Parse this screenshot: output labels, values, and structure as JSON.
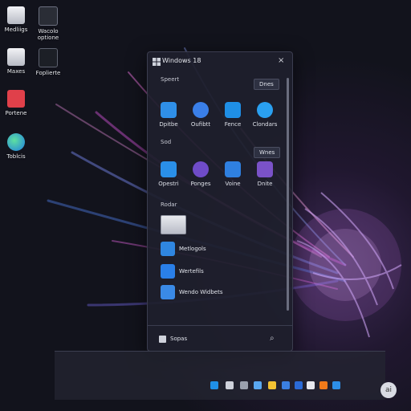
{
  "desktop": {
    "icons": [
      {
        "label": "Medliigs",
        "icon": "file-icon"
      },
      {
        "label": "Wacolo optione",
        "icon": "document-icon"
      },
      {
        "label": "Maxes",
        "icon": "file-icon"
      },
      {
        "label": "Foplierte",
        "icon": "document-icon"
      },
      {
        "label": "Portene",
        "icon": "search-app-icon"
      },
      {
        "label": "Toblcis",
        "icon": "edge-browser-icon"
      }
    ]
  },
  "start_panel": {
    "title": "Windows 18",
    "close": "×",
    "section1": {
      "label": "Speert",
      "button": "Dnes"
    },
    "apps_row1": [
      {
        "label": "Dpitbe",
        "icon": "folder-icon"
      },
      {
        "label": "Oufibtt",
        "icon": "messenger-icon"
      },
      {
        "label": "Fence",
        "icon": "download-icon"
      },
      {
        "label": "Clondars",
        "icon": "cloud-icon"
      }
    ],
    "section2": {
      "label": "Sod",
      "button": "Wnes"
    },
    "apps_row2": [
      {
        "label": "Opestri",
        "icon": "store-icon"
      },
      {
        "label": "Ponges",
        "icon": "power-icon"
      },
      {
        "label": "Voine",
        "icon": "widgets-icon"
      },
      {
        "label": "Dnite",
        "icon": "files-icon"
      }
    ],
    "section3": {
      "label": "Rodar"
    },
    "list": [
      {
        "label": "Metlogols",
        "icon": "app-icon"
      },
      {
        "label": "Wertefils",
        "icon": "refresh-icon"
      },
      {
        "label": "Wendo Widbets",
        "icon": "widgets-icon"
      }
    ],
    "footer": {
      "label": "Sopas",
      "search": "⌕"
    }
  },
  "taskbar": {
    "ai_badge": "ai",
    "colors": [
      "#1f8fe6",
      "#cfd2db",
      "#9aa0ad",
      "#5aa8f0",
      "#f2c233",
      "#3b7fe0",
      "#2b6ad6",
      "#e8e8ee",
      "#f07a1a",
      "#2d8fe8"
    ]
  }
}
